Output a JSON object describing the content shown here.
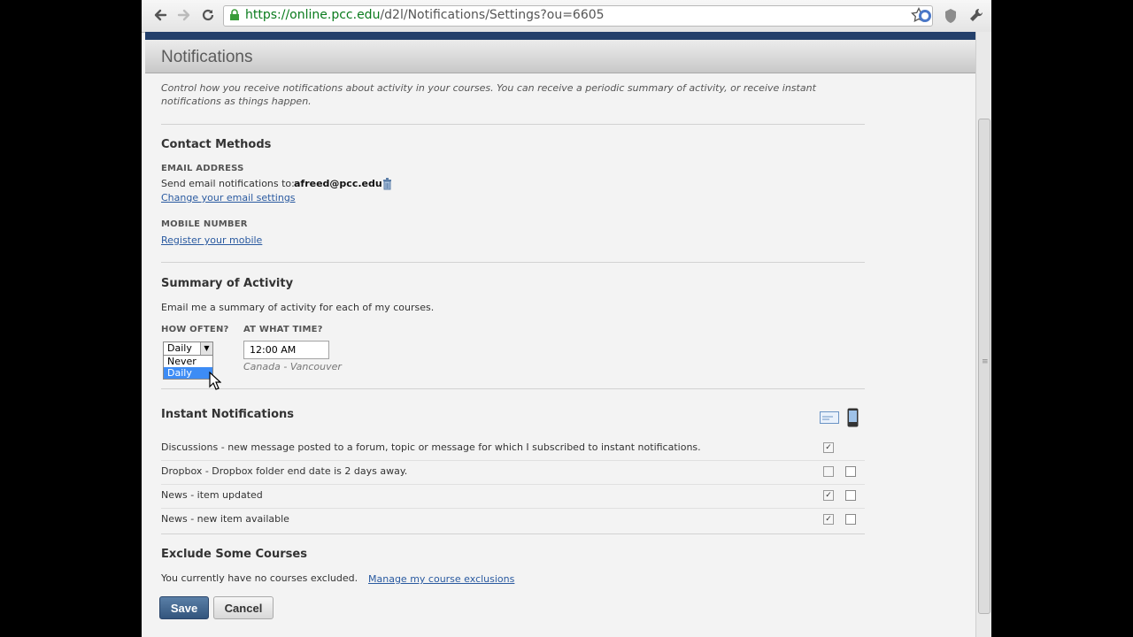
{
  "browser": {
    "url_host": "https://online.pcc.edu",
    "url_path": "/d2l/Notifications/Settings?ou=6605"
  },
  "page": {
    "title": "Notifications",
    "intro": "Control how you receive notifications about activity in your courses. You can receive a periodic summary of activity, or receive instant notifications as things happen."
  },
  "contact": {
    "heading": "Contact Methods",
    "email_label": "EMAIL ADDRESS",
    "email_prefix": "Send email notifications to:",
    "email_value": "afreed@pcc.edu",
    "email_link": "Change your email settings",
    "mobile_label": "MOBILE NUMBER",
    "mobile_link": "Register your mobile"
  },
  "summary": {
    "heading": "Summary of Activity",
    "description": "Email me a summary of activity for each of my courses.",
    "how_often_label": "HOW OFTEN?",
    "time_label": "AT WHAT TIME?",
    "frequency_value": "Daily",
    "frequency_options": [
      "Never",
      "Daily"
    ],
    "time_value": "12:00 AM",
    "timezone": "Canada - Vancouver"
  },
  "instant": {
    "heading": "Instant Notifications",
    "rows": [
      {
        "label": "Discussions - new message posted to a forum, topic or message for which I subscribed to instant notifications.",
        "email": true,
        "mobile": null
      },
      {
        "label": "Dropbox - Dropbox folder end date is 2 days away.",
        "email": false,
        "mobile": false
      },
      {
        "label": "News - item updated",
        "email": true,
        "mobile": false
      },
      {
        "label": "News - new item available",
        "email": true,
        "mobile": false
      }
    ]
  },
  "exclude": {
    "heading": "Exclude Some Courses",
    "status": "You currently have no courses excluded.",
    "link": "Manage my course exclusions"
  },
  "buttons": {
    "save": "Save",
    "cancel": "Cancel"
  },
  "icons": {
    "back": "back-arrow-icon",
    "forward": "forward-arrow-icon",
    "reload": "reload-icon",
    "lock": "lock-icon",
    "star": "bookmark-star-icon",
    "delete": "trash-icon",
    "email_channel": "email-channel-icon",
    "mobile_channel": "mobile-channel-icon",
    "wrench": "wrench-icon"
  }
}
